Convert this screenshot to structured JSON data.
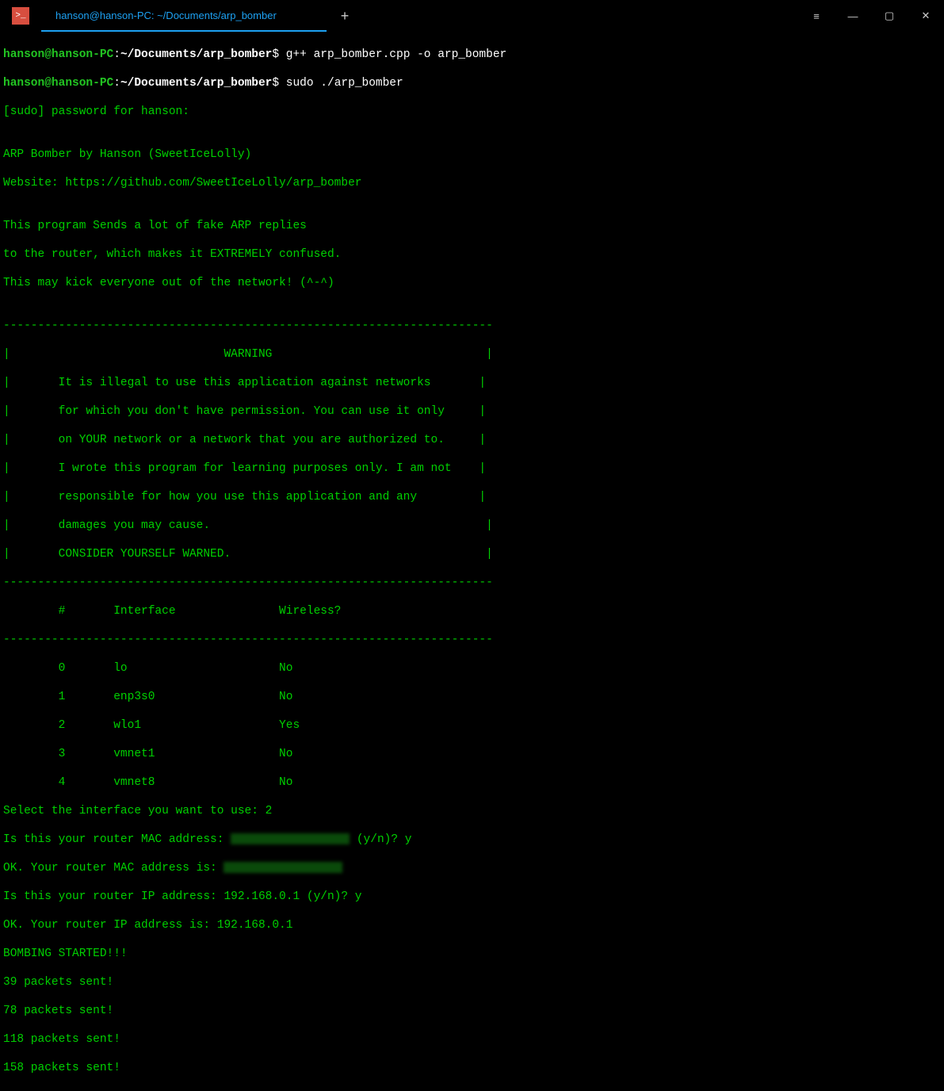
{
  "window": {
    "tab_title": "hanson@hanson-PC: ~/Documents/arp_bomber",
    "add_tab": "+",
    "menu_glyph": "≡",
    "min_glyph": "—",
    "max_glyph": "▢",
    "close_glyph": "✕",
    "app_glyph": ">_"
  },
  "prompt": {
    "user_host": "hanson@hanson-PC",
    "colon": ":",
    "path": "~/Documents/arp_bomber",
    "dollar": "$"
  },
  "cmds": {
    "c1": " g++ arp_bomber.cpp -o arp_bomber",
    "c2": " sudo ./arp_bomber"
  },
  "out": {
    "l01": "[sudo] password for hanson: ",
    "l02": "",
    "l03": "ARP Bomber by Hanson (SweetIceLolly)",
    "l04": "Website: https://github.com/SweetIceLolly/arp_bomber",
    "l05": "",
    "l06": "This program Sends a lot of fake ARP replies",
    "l07": "to the router, which makes it EXTREMELY confused.",
    "l08": "This may kick everyone out of the network! (^-^)",
    "l09": "",
    "l10": "-----------------------------------------------------------------------",
    "l11": "|                               WARNING                               |",
    "l12": "|       It is illegal to use this application against networks       |",
    "l13": "|       for which you don't have permission. You can use it only     |",
    "l14": "|       on YOUR network or a network that you are authorized to.     |",
    "l15": "|       I wrote this program for learning purposes only. I am not    |",
    "l16": "|       responsible for how you use this application and any         |",
    "l17": "|       damages you may cause.                                        |",
    "l18": "|       CONSIDER YOURSELF WARNED.                                     |",
    "l19": "-----------------------------------------------------------------------",
    "l20": "        #       Interface               Wireless?",
    "l21": "-----------------------------------------------------------------------",
    "l22": "        0       lo                      No",
    "l23": "        1       enp3s0                  No",
    "l24": "        2       wlo1                    Yes",
    "l25": "        3       vmnet1                  No",
    "l26": "        4       vmnet8                  No",
    "l27": "Select the interface you want to use: 2",
    "l28a": "Is this your router MAC address: ",
    "l28b": " (y/n)? y",
    "l29a": "OK. Your router MAC address is: ",
    "l30": "Is this your router IP address: 192.168.0.1 (y/n)? y",
    "l31": "OK. Your router IP address is: 192.168.0.1",
    "l32": "BOMBING STARTED!!!",
    "l33": "39 packets sent!",
    "l34": "78 packets sent!",
    "l35": "118 packets sent!",
    "l36": "158 packets sent!"
  }
}
